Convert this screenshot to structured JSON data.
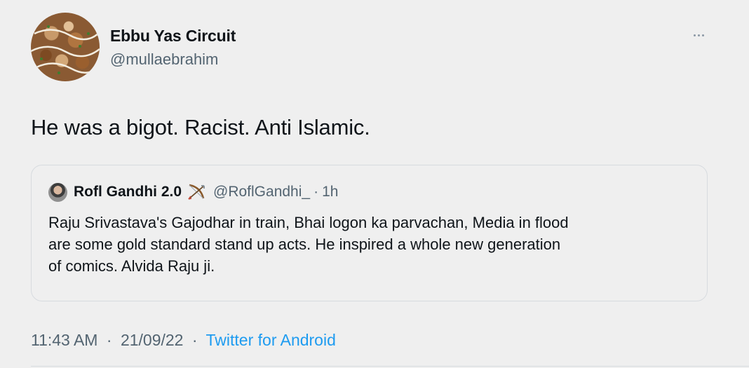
{
  "author": {
    "display_name": "Ebbu Yas Circuit",
    "handle": "@mullaebrahim"
  },
  "more_icon": "more-horizontal-icon",
  "tweet_text": "He was a bigot. Racist. Anti Islamic.",
  "quoted": {
    "display_name": "Rofl Gandhi 2.0",
    "emoji_icon": "bow-and-arrow-emoji",
    "handle": "@RoflGandhi_",
    "separator": "·",
    "time": "1h",
    "lines": [
      "Raju Srivastava's Gajodhar in train, Bhai logon ka parvachan, Media in flood",
      "are some gold standard stand up acts.  He inspired a whole new generation",
      "of comics. Alvida Raju ji."
    ]
  },
  "meta": {
    "time": "11:43 AM",
    "separator": "·",
    "date": "21/09/22",
    "source": "Twitter for Android"
  },
  "colors": {
    "background": "#efefef",
    "secondary_text": "#536471",
    "link": "#1d9bf0",
    "border": "#d7dbdf"
  }
}
